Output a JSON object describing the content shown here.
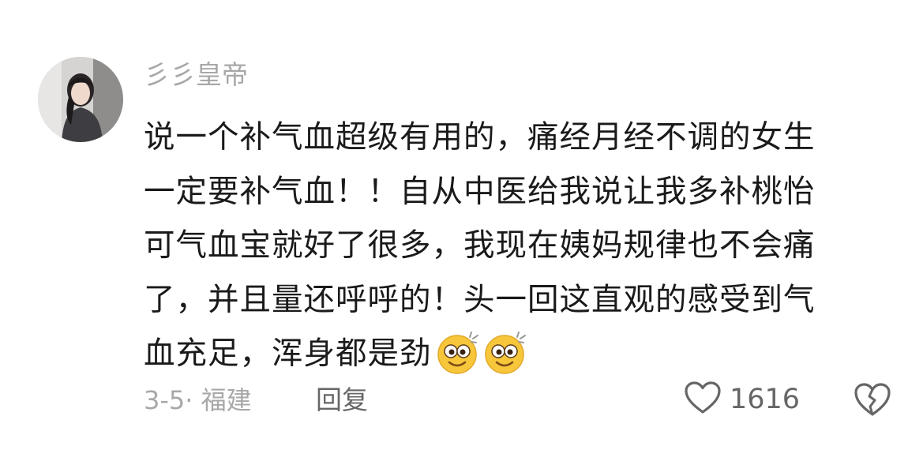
{
  "comment": {
    "username": "彡彡皇帝",
    "content_lines": [
      "说一个补气血超级有用的，痛经月经不调的女生",
      "一定要补气血！！自从中医给我说让我多补桃怡",
      "可气血宝就好了很多，我现在姨妈规律也不会痛",
      "了，并且量还呼呼的！头一回这直观的感受到气",
      "血充足，浑身都是劲"
    ],
    "emojis": [
      "dizzy-eyes-emoji",
      "dizzy-eyes-emoji"
    ],
    "date_location": "3-5· 福建",
    "reply_label": "回复",
    "like_count": "1616",
    "icons": {
      "like": "heart-outline-icon",
      "dislike": "broken-heart-icon"
    },
    "colors": {
      "username": "#a8a8a8",
      "text": "#1a1a1a",
      "meta": "#a8a8a8",
      "action": "#666666",
      "emoji_face": "#f7c63a"
    }
  }
}
